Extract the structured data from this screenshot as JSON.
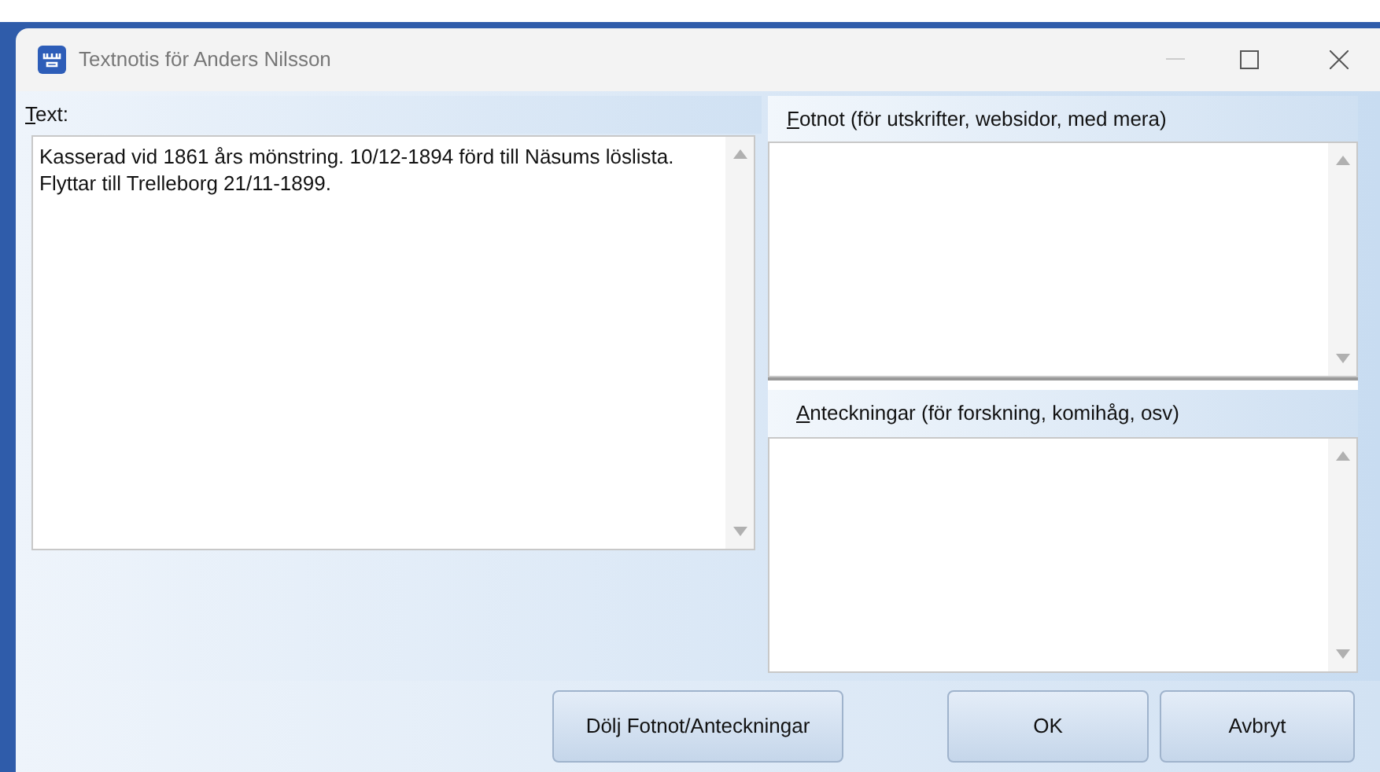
{
  "window": {
    "title": "Textnotis för Anders Nilsson"
  },
  "text_panel": {
    "label": "Text:",
    "value": "Kasserad vid 1861 års mönstring. 10/12-1894 förd till Näsums löslista. Flyttar till Trelleborg 21/11-1899."
  },
  "footnote_panel": {
    "label": "Fotnot (för utskrifter, websidor, med mera)"
  },
  "notes_panel": {
    "label": "Anteckningar (för forskning, komihåg, osv)"
  },
  "buttons": [
    "Dölj Fotnot/Anteckningar",
    "OK",
    "Avbryt"
  ]
}
